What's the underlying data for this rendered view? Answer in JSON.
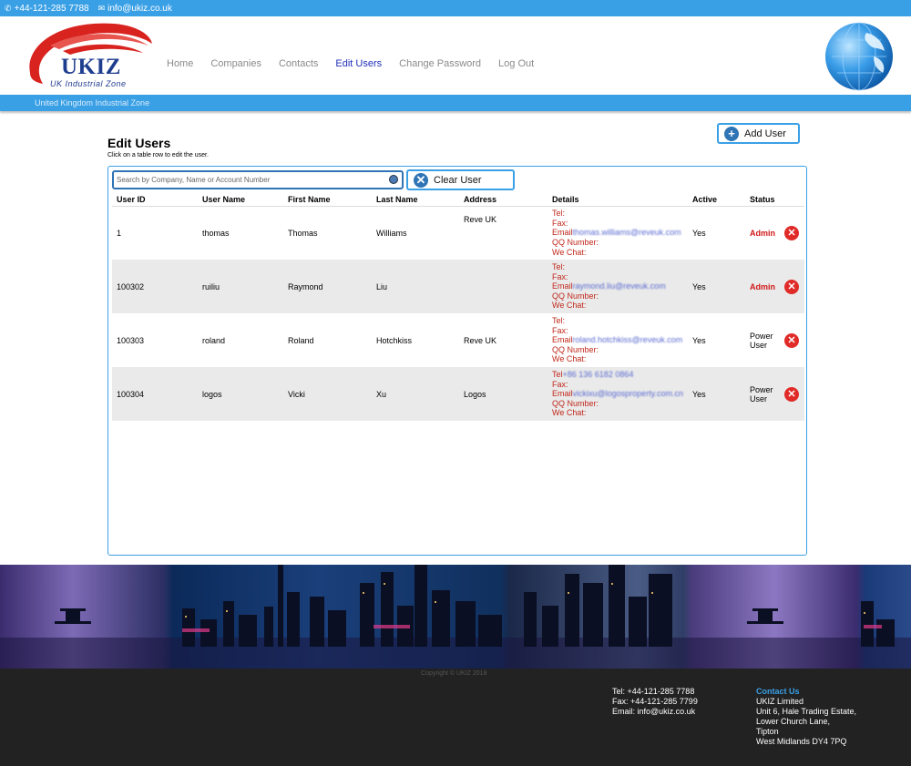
{
  "topbar": {
    "phone": "+44-121-285 7788",
    "email": "info@ukiz.co.uk",
    "phone_icon": "phone-icon",
    "email_icon": "envelope-icon"
  },
  "header": {
    "logo_text": "UKIZ",
    "logo_sub": "UK Industrial Zone",
    "nav": [
      "Home",
      "Companies",
      "Contacts",
      "Edit Users",
      "Change Password",
      "Log Out"
    ],
    "active_nav": "Edit Users"
  },
  "subbar": {
    "text": "United Kingdom Industrial Zone"
  },
  "page": {
    "title": "Edit Users",
    "subtitle": "Click on a table row to edit the user.",
    "add_user": "Add User",
    "clear_user": "Clear User",
    "search_placeholder": "Search by Company, Name or Account Number"
  },
  "table": {
    "columns": [
      "User ID",
      "User Name",
      "First Name",
      "Last Name",
      "Address",
      "Details",
      "Active",
      "Status"
    ],
    "rows": [
      {
        "id": "1",
        "username": "thomas",
        "first": "Thomas",
        "last": "Williams",
        "address": "Reve UK",
        "tel": "Tel:",
        "tel_val": "",
        "fax": "Fax:",
        "email": "Email",
        "email_val": "thomas.williams@reveuk.com",
        "qq": "QQ Number:",
        "wechat": "We Chat:",
        "active": "Yes",
        "status": "Admin"
      },
      {
        "id": "100302",
        "username": "ruiliu",
        "first": "Raymond",
        "last": "Liu",
        "address": "",
        "tel": "Tel:",
        "tel_val": "",
        "fax": "Fax:",
        "email": "Email",
        "email_val": "raymond.liu@reveuk.com",
        "qq": "QQ Number:",
        "wechat": "We Chat:",
        "active": "Yes",
        "status": "Admin"
      },
      {
        "id": "100303",
        "username": "roland",
        "first": "Roland",
        "last": "Hotchkiss",
        "address": "Reve UK",
        "tel": "Tel:",
        "tel_val": "",
        "fax": "Fax:",
        "email": "Email",
        "email_val": "roland.hotchkiss@reveuk.com",
        "qq": "QQ Number:",
        "wechat": "We Chat:",
        "active": "Yes",
        "status": "Power User"
      },
      {
        "id": "100304",
        "username": "logos",
        "first": "Vicki",
        "last": "Xu",
        "address": "Logos",
        "tel": "Tel",
        "tel_val": "+86 136 6182 0864",
        "fax": "Fax:",
        "email": "Email",
        "email_val": "vickixu@logosproperty.com.cn",
        "qq": "QQ Number:",
        "wechat": "We Chat:",
        "active": "Yes",
        "status": "Power User"
      }
    ]
  },
  "footer": {
    "copyright": "Copyright © UKIZ 2018",
    "tel": "Tel: +44-121-285 7788",
    "fax": "Fax: +44-121-285 7799",
    "email": "Email: info@ukiz.co.uk",
    "contact_heading": "Contact Us",
    "addr": [
      "UKIZ Limited",
      "Unit 6, Hale Trading Estate,",
      "Lower Church Lane,",
      "Tipton",
      "West Midlands DY4 7PQ"
    ]
  },
  "colors": {
    "accent": "#3aa0e6",
    "nav_active": "#1f2fb8",
    "details_red": "#c0281b",
    "admin_red": "#d0181a",
    "footer_bg": "#222222"
  }
}
